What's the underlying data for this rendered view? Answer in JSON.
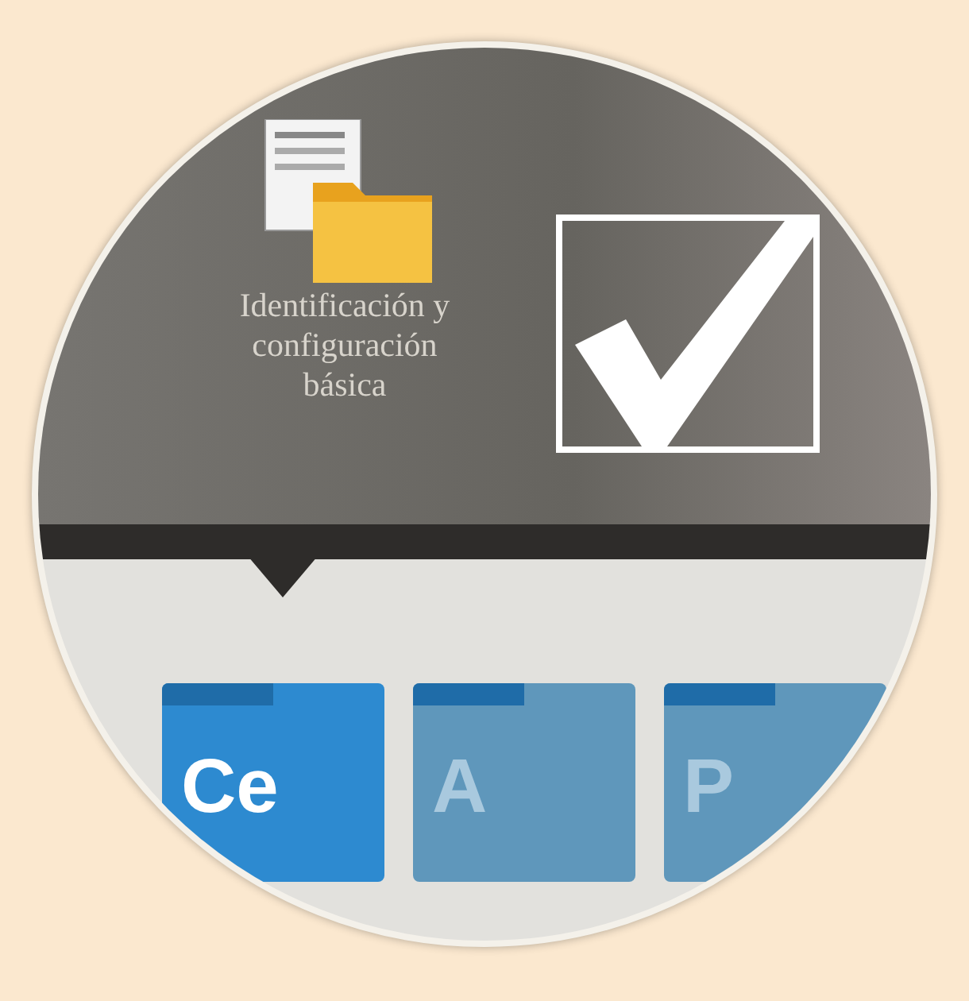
{
  "top_panel": {
    "item": {
      "label_lines": [
        "Identificación y",
        "configuración",
        "básica"
      ]
    },
    "checkbox": {
      "checked": true
    }
  },
  "tiles": [
    {
      "label": "Ce",
      "blurred": false
    },
    {
      "label": "A",
      "blurred": true
    },
    {
      "label": "P",
      "blurred": true
    }
  ]
}
